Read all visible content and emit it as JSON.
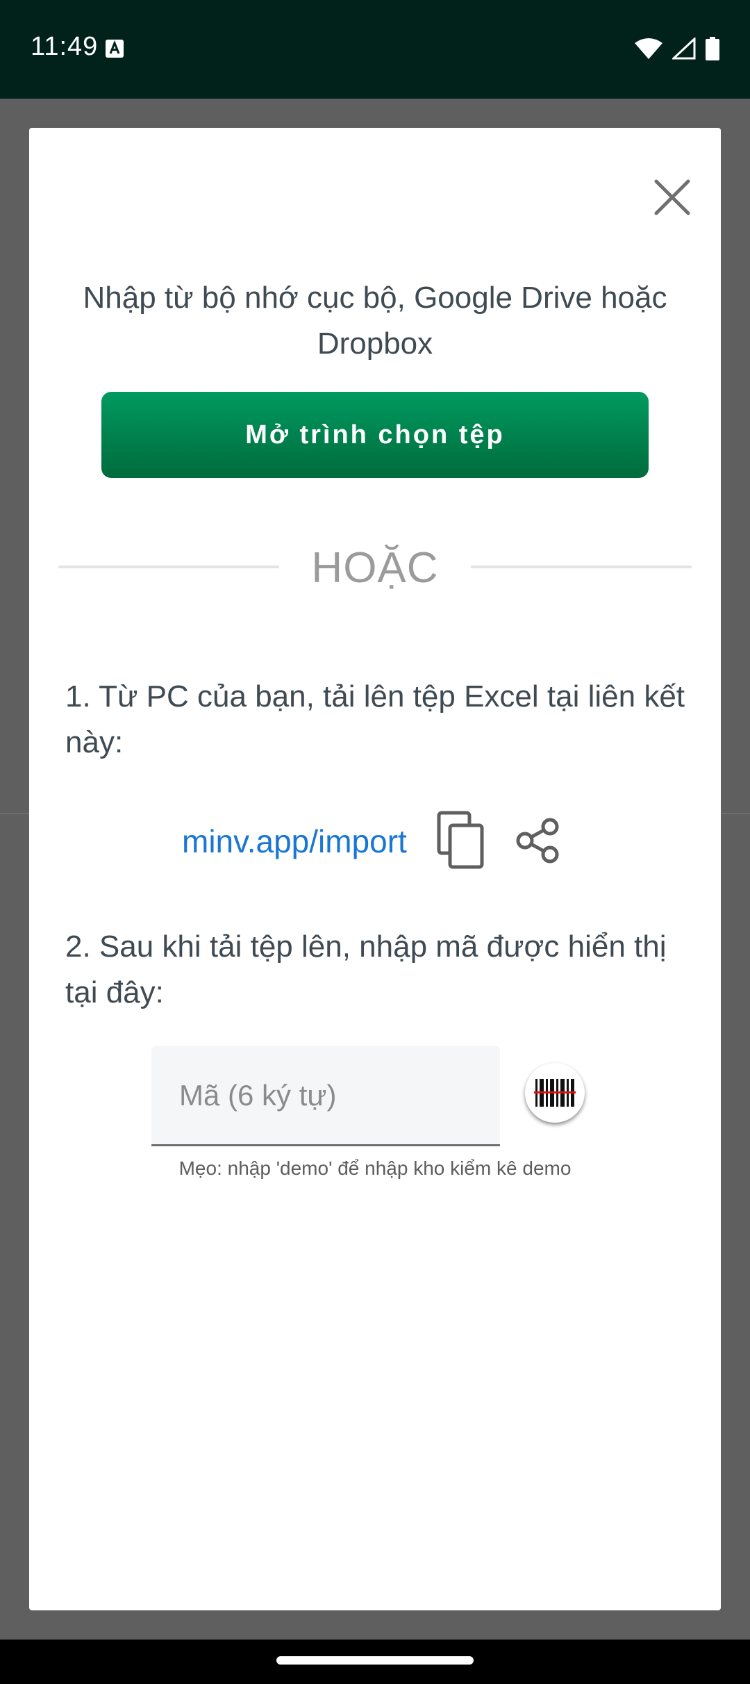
{
  "status_bar": {
    "time": "11:49",
    "icons": [
      "keyboard-a-icon",
      "wifi-icon",
      "signal-icon",
      "battery-icon"
    ]
  },
  "dialog": {
    "close_icon": "close-icon",
    "intro": "Nhập từ bộ nhớ cục bộ, Google Drive hoặc Dropbox",
    "open_picker_label": "Mở trình chọn tệp",
    "or_label": "HOẶC",
    "step1": "1. Từ PC của bạn, tải lên tệp Excel tại liên kết này:",
    "import_link": "minv.app/import",
    "copy_icon": "copy-icon",
    "share_icon": "share-icon",
    "step2": "2. Sau khi tải tệp lên, nhập mã được hiển thị tại đây:",
    "code_placeholder": "Mã (6 ký tự)",
    "code_value": "",
    "scan_icon": "barcode-scan-icon",
    "tip": "Mẹo: nhập 'demo' để nhập kho kiểm kê demo"
  },
  "colors": {
    "status_bar": "#00221a",
    "primary_button_top": "#009a60",
    "primary_button_bottom": "#006b3c",
    "link": "#1976d2",
    "text": "#3f4a52",
    "muted": "#9b9b9b",
    "backdrop": "#5f5f5f"
  }
}
